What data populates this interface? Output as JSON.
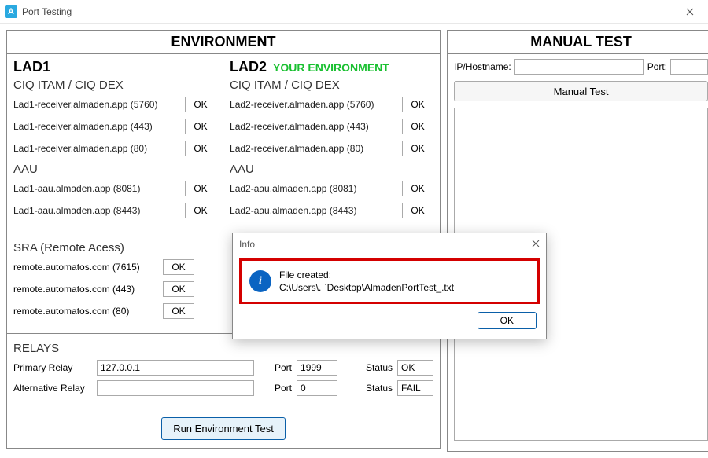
{
  "window": {
    "title": "Port Testing",
    "app_icon_letter": "A"
  },
  "environment": {
    "header": "ENVIRONMENT",
    "lad1": {
      "title": "LAD1",
      "groups": [
        {
          "label": "CIQ ITAM / CIQ DEX",
          "hosts": [
            {
              "addr": "Lad1-receiver.almaden.app (5760)",
              "status": "OK"
            },
            {
              "addr": "Lad1-receiver.almaden.app (443)",
              "status": "OK"
            },
            {
              "addr": "Lad1-receiver.almaden.app (80)",
              "status": "OK"
            }
          ]
        },
        {
          "label": "AAU",
          "hosts": [
            {
              "addr": "Lad1-aau.almaden.app (8081)",
              "status": "OK"
            },
            {
              "addr": "Lad1-aau.almaden.app (8443)",
              "status": "OK"
            }
          ]
        }
      ]
    },
    "lad2": {
      "title": "LAD2",
      "badge": "YOUR ENVIRONMENT",
      "groups": [
        {
          "label": "CIQ ITAM / CIQ DEX",
          "hosts": [
            {
              "addr": "Lad2-receiver.almaden.app (5760)",
              "status": "OK"
            },
            {
              "addr": "Lad2-receiver.almaden.app (443)",
              "status": "OK"
            },
            {
              "addr": "Lad2-receiver.almaden.app (80)",
              "status": "OK"
            }
          ]
        },
        {
          "label": "AAU",
          "hosts": [
            {
              "addr": "Lad2-aau.almaden.app (8081)",
              "status": "OK"
            },
            {
              "addr": "Lad2-aau.almaden.app (8443)",
              "status": "OK"
            }
          ]
        }
      ]
    },
    "sra": {
      "label": "SRA (Remote Acess)",
      "hosts": [
        {
          "addr": "remote.automatos.com (7615)",
          "status": "OK"
        },
        {
          "addr": "remote.automatos.com (443)",
          "status": "OK"
        },
        {
          "addr": "remote.automatos.com (80)",
          "status": "OK"
        }
      ]
    },
    "relays": {
      "label": "RELAYS",
      "primary_label": "Primary Relay",
      "alt_label": "Alternative Relay",
      "port_label": "Port",
      "status_label": "Status",
      "primary": {
        "host": "127.0.0.1",
        "port": "1999",
        "status": "OK"
      },
      "alt": {
        "host": "",
        "port": "0",
        "status": "FAIL"
      }
    },
    "run_button": "Run Environment Test"
  },
  "manual": {
    "header": "MANUAL TEST",
    "ip_label": "IP/Hostname:",
    "port_label": "Port:",
    "ip_value": "",
    "port_value": "",
    "button": "Manual Test"
  },
  "modal": {
    "title": "Info",
    "message": "File created:\nC:\\Users\\.                              `Desktop\\AlmadenPortTest_.txt",
    "ok": "OK"
  }
}
